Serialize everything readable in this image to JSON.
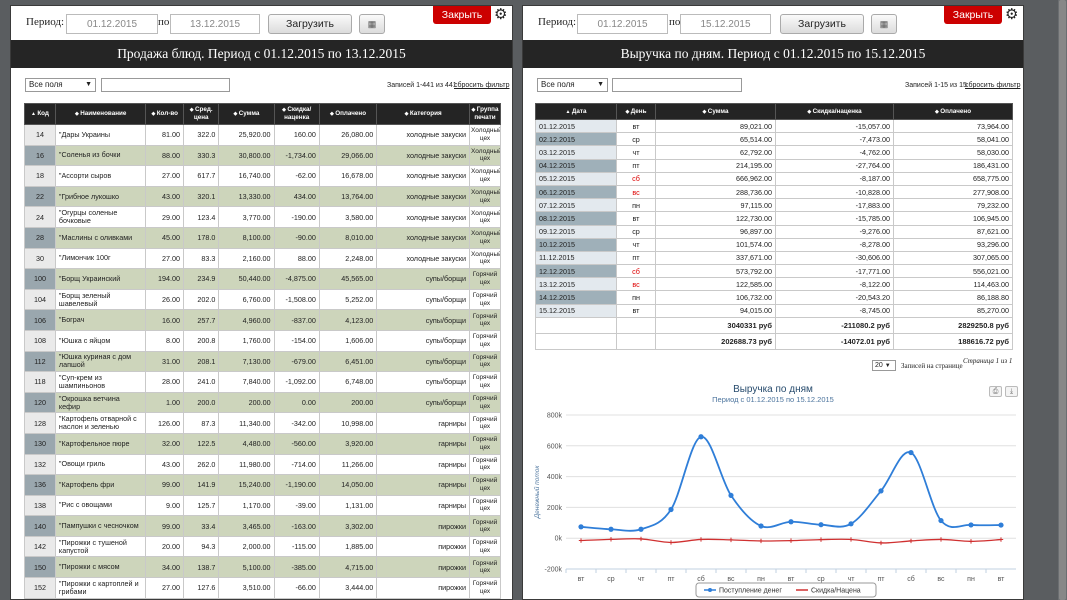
{
  "left": {
    "period_label": "Период: с",
    "to_label": "по",
    "date_from": "01.12.2015",
    "date_to": "13.12.2015",
    "load_label": "Загрузить",
    "close_label": "Закрыть",
    "title": "Продажа блюд. Период с 01.12.2015 по 13.12.2015",
    "filter_label": "Все поля",
    "records": "Записей 1-441 из 441",
    "reset": "сбросить фильтр",
    "headers": [
      "Код",
      "Наименование",
      "Кол-во",
      "Сред. цена",
      "Сумма",
      "Скидка/ наценка",
      "Оплачено",
      "Категория",
      "Группа печати"
    ],
    "rows": [
      [
        "14",
        "\"Дары Украины",
        "81.00",
        "322.0",
        "25,920.00",
        "160.00",
        "26,080.00",
        "холодные закуски",
        "Холодный цех"
      ],
      [
        "16",
        "\"Соленья из бочки",
        "88.00",
        "330.3",
        "30,800.00",
        "-1,734.00",
        "29,066.00",
        "холодные закуски",
        "Холодный цех"
      ],
      [
        "18",
        "\"Ассорти сыров",
        "27.00",
        "617.7",
        "16,740.00",
        "-62.00",
        "16,678.00",
        "холодные закуски",
        "Холодный цех"
      ],
      [
        "22",
        "\"Грибное лукошко",
        "43.00",
        "320.1",
        "13,330.00",
        "434.00",
        "13,764.00",
        "холодные закуски",
        "Холодный цех"
      ],
      [
        "24",
        "\"Огурцы соленые бочковые",
        "29.00",
        "123.4",
        "3,770.00",
        "-190.00",
        "3,580.00",
        "холодные закуски",
        "Холодный цех"
      ],
      [
        "28",
        "\"Маслины с оливками",
        "45.00",
        "178.0",
        "8,100.00",
        "-90.00",
        "8,010.00",
        "холодные закуски",
        "Холодный цех"
      ],
      [
        "30",
        "\"Лимончик 100г",
        "27.00",
        "83.3",
        "2,160.00",
        "88.00",
        "2,248.00",
        "холодные закуски",
        "Холодный цех"
      ],
      [
        "100",
        "\"Борщ Украинский",
        "194.00",
        "234.9",
        "50,440.00",
        "-4,875.00",
        "45,565.00",
        "супы/борщи",
        "Горячий цех"
      ],
      [
        "104",
        "\"Борщ зеленый шавелевый",
        "26.00",
        "202.0",
        "6,760.00",
        "-1,508.00",
        "5,252.00",
        "супы/борщи",
        "Горячий цех"
      ],
      [
        "106",
        "\"Бограч",
        "16.00",
        "257.7",
        "4,960.00",
        "-837.00",
        "4,123.00",
        "супы/борщи",
        "Горячий цех"
      ],
      [
        "108",
        "\"Юшка с яйцом",
        "8.00",
        "200.8",
        "1,760.00",
        "-154.00",
        "1,606.00",
        "супы/борщи",
        "Горячий цех"
      ],
      [
        "112",
        "\"Юшка куриная с дом лапшой",
        "31.00",
        "208.1",
        "7,130.00",
        "-679.00",
        "6,451.00",
        "супы/борщи",
        "Горячий цех"
      ],
      [
        "118",
        "\"Суп-крем из шампиньонов",
        "28.00",
        "241.0",
        "7,840.00",
        "-1,092.00",
        "6,748.00",
        "супы/борщи",
        "Горячий цех"
      ],
      [
        "120",
        "\"Окрошка ветчина кефир",
        "1.00",
        "200.0",
        "200.00",
        "0.00",
        "200.00",
        "супы/борщи",
        "Горячий цех"
      ],
      [
        "128",
        "\"Картофель отварной с наслон и зеленью",
        "126.00",
        "87.3",
        "11,340.00",
        "-342.00",
        "10,998.00",
        "гарниры",
        "Горячий цех"
      ],
      [
        "130",
        "\"Картофельное пюре",
        "32.00",
        "122.5",
        "4,480.00",
        "-560.00",
        "3,920.00",
        "гарниры",
        "Горячий цех"
      ],
      [
        "132",
        "\"Овощи гриль",
        "43.00",
        "262.0",
        "11,980.00",
        "-714.00",
        "11,266.00",
        "гарниры",
        "Горячий цех"
      ],
      [
        "136",
        "\"Картофель фри",
        "99.00",
        "141.9",
        "15,240.00",
        "-1,190.00",
        "14,050.00",
        "гарниры",
        "Горячий цех"
      ],
      [
        "138",
        "\"Рис с овощами",
        "9.00",
        "125.7",
        "1,170.00",
        "-39.00",
        "1,131.00",
        "гарниры",
        "Горячий цех"
      ],
      [
        "140",
        "\"Пампушки с чесночком",
        "99.00",
        "33.4",
        "3,465.00",
        "-163.00",
        "3,302.00",
        "пирожки",
        "Горячий цех"
      ],
      [
        "142",
        "\"Пирожки с тушеной капустой",
        "20.00",
        "94.3",
        "2,000.00",
        "-115.00",
        "1,885.00",
        "пирожки",
        "Горячий цех"
      ],
      [
        "150",
        "\"Пирожки с мясом",
        "34.00",
        "138.7",
        "5,100.00",
        "-385.00",
        "4,715.00",
        "пирожки",
        "Горячий цех"
      ],
      [
        "152",
        "\"Пирожки с картоплей и грибами",
        "27.00",
        "127.6",
        "3,510.00",
        "-66.00",
        "3,444.00",
        "пирожки",
        "Горячий цех"
      ]
    ]
  },
  "right": {
    "period_label": "Период: с",
    "to_label": "по",
    "date_from": "01.12.2015",
    "date_to": "15.12.2015",
    "load_label": "Загрузить",
    "close_label": "Закрыть",
    "title": "Выручка по дням. Период с 01.12.2015 по 15.12.2015",
    "filter_label": "Все поля",
    "records": "Записей 1-15 из 15",
    "reset": "сбросить фильтр",
    "headers": [
      "Дата",
      "День",
      "Сумма",
      "Скидка/наценка",
      "Оплачено"
    ],
    "rows": [
      [
        "01.12.2015",
        "вт",
        "89,021.00",
        "-15,057.00",
        "73,964.00"
      ],
      [
        "02.12.2015",
        "ср",
        "65,514.00",
        "-7,473.00",
        "58,041.00"
      ],
      [
        "03.12.2015",
        "чт",
        "62,792.00",
        "-4,762.00",
        "58,030.00"
      ],
      [
        "04.12.2015",
        "пт",
        "214,195.00",
        "-27,764.00",
        "186,431.00"
      ],
      [
        "05.12.2015",
        "сб",
        "666,962.00",
        "-8,187.00",
        "658,775.00"
      ],
      [
        "06.12.2015",
        "вс",
        "288,736.00",
        "-10,828.00",
        "277,908.00"
      ],
      [
        "07.12.2015",
        "пн",
        "97,115.00",
        "-17,883.00",
        "79,232.00"
      ],
      [
        "08.12.2015",
        "вт",
        "122,730.00",
        "-15,785.00",
        "106,945.00"
      ],
      [
        "09.12.2015",
        "ср",
        "96,897.00",
        "-9,276.00",
        "87,621.00"
      ],
      [
        "10.12.2015",
        "чт",
        "101,574.00",
        "-8,278.00",
        "93,296.00"
      ],
      [
        "11.12.2015",
        "пт",
        "337,671.00",
        "-30,606.00",
        "307,065.00"
      ],
      [
        "12.12.2015",
        "сб",
        "573,792.00",
        "-17,771.00",
        "556,021.00"
      ],
      [
        "13.12.2015",
        "вс",
        "122,585.00",
        "-8,122.00",
        "114,463.00"
      ],
      [
        "14.12.2015",
        "пн",
        "106,732.00",
        "-20,543.20",
        "86,188.80"
      ],
      [
        "15.12.2015",
        "вт",
        "94,015.00",
        "-8,745.00",
        "85,270.00"
      ]
    ],
    "weekend_days": [
      "сб",
      "вс"
    ],
    "total_row": [
      "",
      "",
      "3040331 руб",
      "-211080.2 руб",
      "2829250.8 руб"
    ],
    "avg_row": [
      "",
      "",
      "202688.73 руб",
      "-14072.01 руб",
      "188616.72 руб"
    ],
    "page_size": "20",
    "page_size_label": "Записей на странице",
    "page_info": "Страница 1 из 1"
  },
  "chart_data": {
    "type": "line",
    "title": "Выручка по дням",
    "subtitle": "Период с 01.12.2015 по 15.12.2015",
    "ylabel": "Денежный поток",
    "ylim": [
      -200000,
      800000
    ],
    "yticks": [
      -200000,
      0,
      200000,
      400000,
      600000,
      800000
    ],
    "ytick_labels": [
      "-200k",
      "0k",
      "200k",
      "400k",
      "600k",
      "800k"
    ],
    "categories": [
      "вт",
      "ср",
      "чт",
      "пт",
      "сб",
      "вс",
      "пн",
      "вт",
      "ср",
      "чт",
      "пт",
      "сб",
      "вс",
      "пн",
      "вт"
    ],
    "series": [
      {
        "name": "Поступление денег",
        "color": "#2f7ed8",
        "values": [
          73964,
          58041,
          58030,
          186431,
          658775,
          277908,
          79232,
          106945,
          87621,
          93296,
          307065,
          556021,
          114463,
          86189,
          85270
        ]
      },
      {
        "name": "Скидка/Нацена",
        "color": "#d03030",
        "values": [
          -15057,
          -7473,
          -4762,
          -27764,
          -8187,
          -10828,
          -17883,
          -15785,
          -9276,
          -8278,
          -30606,
          -17771,
          -8122,
          -20543,
          -8745
        ]
      }
    ]
  }
}
